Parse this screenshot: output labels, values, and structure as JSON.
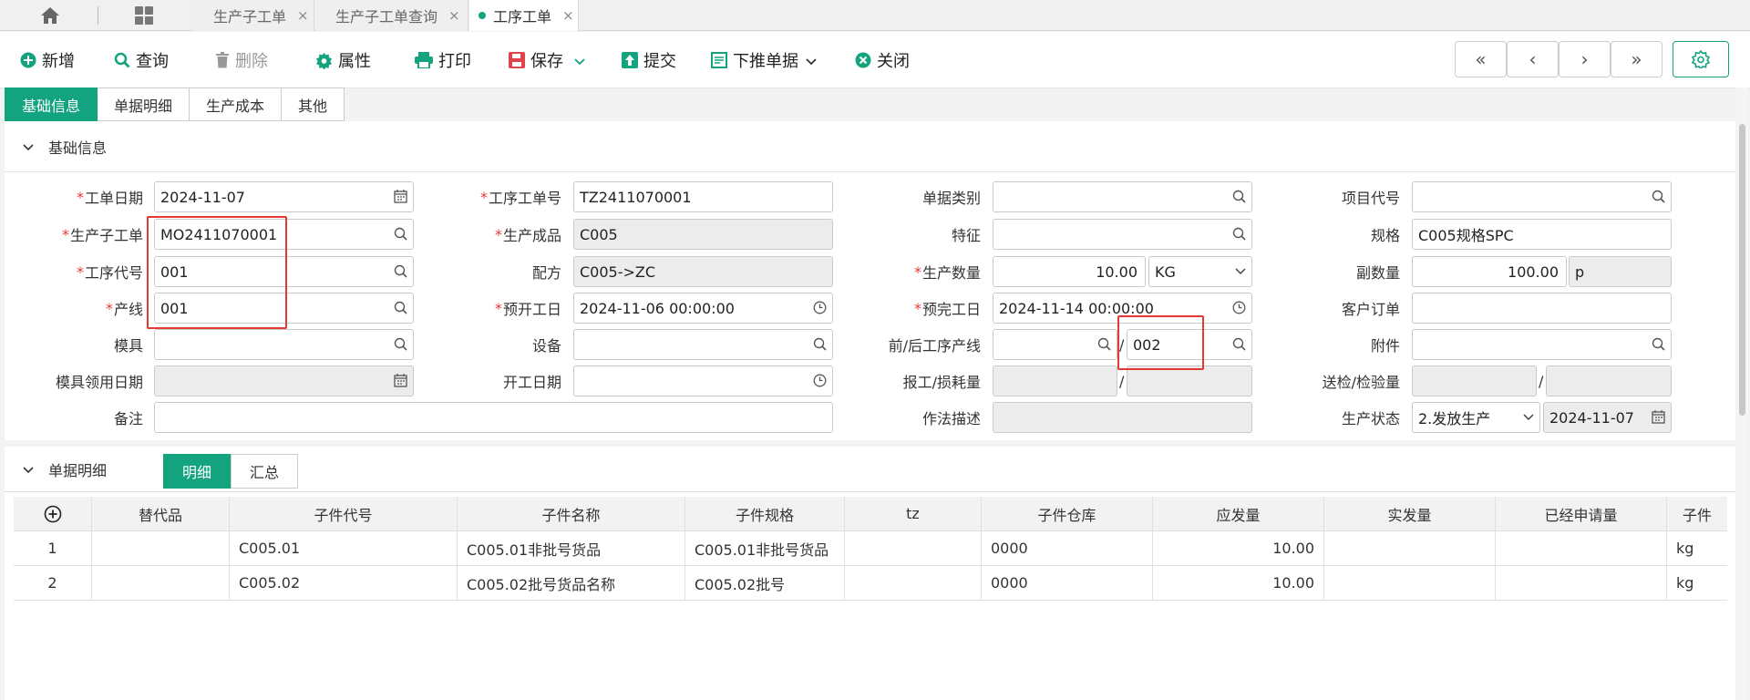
{
  "tabs": [
    {
      "label": "生产子工单",
      "close": "×"
    },
    {
      "label": "生产子工单查询",
      "close": "×"
    },
    {
      "label": "工序工单",
      "close": "×",
      "active": true
    }
  ],
  "toolbar": {
    "new": "新增",
    "query": "查询",
    "delete": "删除",
    "props": "属性",
    "print": "打印",
    "save": "保存",
    "submit": "提交",
    "push": "下推单据",
    "close": "关闭"
  },
  "section_tabs": [
    "基础信息",
    "单据明细",
    "生产成本",
    "其他"
  ],
  "form": {
    "header": "基础信息",
    "fields": {
      "work_date": {
        "label": "工单日期",
        "value": "2024-11-07"
      },
      "sub_order": {
        "label": "生产子工单",
        "value": "MO2411070001"
      },
      "proc_code": {
        "label": "工序代号",
        "value": "001"
      },
      "line": {
        "label": "产线",
        "value": "001"
      },
      "mold": {
        "label": "模具",
        "value": ""
      },
      "mold_date": {
        "label": "模具领用日期",
        "value": ""
      },
      "remark": {
        "label": "备注",
        "value": ""
      },
      "proc_order": {
        "label": "工序工单号",
        "value": "TZ2411070001"
      },
      "product": {
        "label": "生产成品",
        "value": "C005"
      },
      "formula": {
        "label": "配方",
        "value": "C005->ZC"
      },
      "plan_start": {
        "label": "预开工日",
        "value": "2024-11-06 00:00:00"
      },
      "equipment": {
        "label": "设备",
        "value": ""
      },
      "start_date": {
        "label": "开工日期",
        "value": ""
      },
      "doc_type": {
        "label": "单据类别",
        "value": ""
      },
      "feature": {
        "label": "特征",
        "value": ""
      },
      "qty": {
        "label": "生产数量",
        "value": "10.00",
        "unit": "KG"
      },
      "plan_end": {
        "label": "预完工日",
        "value": "2024-11-14 00:00:00"
      },
      "prev_next_line": {
        "label": "前/后工序产线",
        "value1": "",
        "value2": "002"
      },
      "report_loss": {
        "label": "报工/损耗量",
        "value1": "",
        "value2": ""
      },
      "method": {
        "label": "作法描述",
        "value": ""
      },
      "project": {
        "label": "项目代号",
        "value": ""
      },
      "spec": {
        "label": "规格",
        "value": "C005规格SPC"
      },
      "sub_qty": {
        "label": "副数量",
        "value": "100.00",
        "unit": "p"
      },
      "customer_order": {
        "label": "客户订单",
        "value": ""
      },
      "attachment": {
        "label": "附件",
        "value": ""
      },
      "inspection": {
        "label": "送检/检验量",
        "value1": "",
        "value2": ""
      },
      "status": {
        "label": "生产状态",
        "value": "2.发放生产",
        "date": "2024-11-07"
      }
    },
    "slash": "/"
  },
  "detail": {
    "header": "单据明细",
    "tabs": [
      "明细",
      "汇总"
    ],
    "columns": [
      "",
      "替代品",
      "子件代号",
      "子件名称",
      "子件规格",
      "tz",
      "子件仓库",
      "应发量",
      "实发量",
      "已经申请量",
      "子件"
    ],
    "rows": [
      [
        "1",
        "",
        "C005.01",
        "C005.01非批号货品",
        "C005.01非批号货品",
        "",
        "0000",
        "10.00",
        "",
        "",
        "kg"
      ],
      [
        "2",
        "",
        "C005.02",
        "C005.02批号货品名称",
        "C005.02批号",
        "",
        "0000",
        "10.00",
        "",
        "",
        "kg"
      ]
    ]
  },
  "colors": {
    "accent": "#14a37f",
    "required": "#e53935",
    "highlight_box": "#e53935"
  }
}
